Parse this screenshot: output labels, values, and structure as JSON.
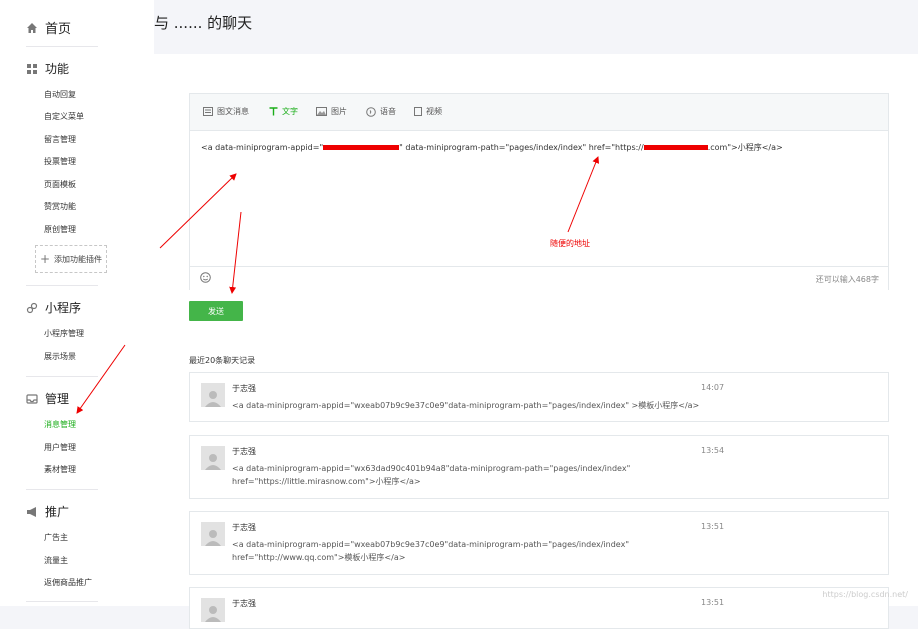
{
  "sidebar": {
    "home": "首页",
    "sections": [
      {
        "label": "功能",
        "items": [
          "自动回复",
          "自定义菜单",
          "留言管理",
          "投票管理",
          "页面模板",
          "赞赏功能",
          "原创管理"
        ]
      },
      {
        "label": "小程序",
        "items": [
          "小程序管理",
          "展示场景"
        ]
      },
      {
        "label": "管理",
        "items": [
          "消息管理",
          "用户管理",
          "素材管理"
        ]
      },
      {
        "label": "推广",
        "items": [
          "广告主",
          "流量主",
          "返佣商品推广"
        ]
      }
    ],
    "add_plugin": "添加功能插件",
    "active_item": "消息管理"
  },
  "header": {
    "title": "与 ...... 的聊天"
  },
  "editor": {
    "tabs": [
      "图文消息",
      "文字",
      "图片",
      "语音",
      "视频"
    ],
    "active_tab": "文字",
    "content_prefix": "<a data-miniprogram-appid=\"",
    "content_middle": "\" data-miniprogram-path=\"pages/index/index\"  href=\"https://",
    "content_suffix": ".com\">小程序</a>",
    "remaining": "还可以输入468字"
  },
  "annotation": "随便的地址",
  "send_label": "发送",
  "history_title": "最近20条聊天记录",
  "messages": [
    {
      "name": "于志强",
      "time": "14:07",
      "text": "<a data-miniprogram-appid=\"wxeab07b9c9e37c0e9\"data-miniprogram-path=\"pages/index/index\" >模板小程序</a>"
    },
    {
      "name": "于志强",
      "time": "13:54",
      "text": "<a data-miniprogram-appid=\"wx63dad90c401b94a8\"data-miniprogram-path=\"pages/index/index\" href=\"https://little.mirasnow.com\">小程序</a>"
    },
    {
      "name": "于志强",
      "time": "13:51",
      "text": "<a data-miniprogram-appid=\"wxeab07b9c9e37c0e9\"data-miniprogram-path=\"pages/index/index\" href=\"http://www.qq.com\">模板小程序</a>"
    },
    {
      "name": "于志强",
      "time": "13:51",
      "text": ""
    }
  ],
  "watermark": "https://blog.csdn.net/",
  "colors": {
    "accent": "#1aad19",
    "button": "#44b549",
    "annotation": "#e00000"
  }
}
